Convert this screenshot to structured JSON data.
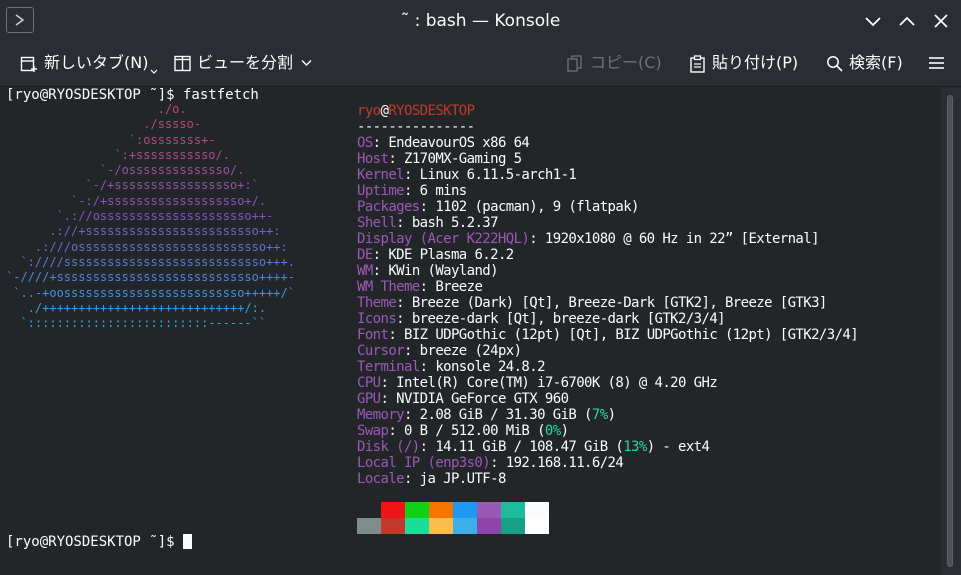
{
  "window": {
    "title": "˜ : bash — Konsole"
  },
  "toolbar": {
    "new_tab": "新しいタブ(N)",
    "split_view": "ビューを分割",
    "copy": "コピー(C)",
    "paste": "貼り付け(P)",
    "search": "検索(F)"
  },
  "terminal": {
    "prompt1": "[ryo@RYOSDESKTOP ˜]$ fastfetch",
    "prompt2": "[ryo@RYOSDESKTOP ˜]$ ",
    "user": "ryo",
    "at": "@",
    "host": "RYOSDESKTOP",
    "rule": "---------------",
    "info": [
      {
        "key": "OS",
        "sep": ": ",
        "value": "EndeavourOS x86 64"
      },
      {
        "key": "Host",
        "sep": ": ",
        "value": "Z170MX-Gaming 5"
      },
      {
        "key": "Kernel",
        "sep": ": ",
        "value": "Linux 6.11.5-arch1-1"
      },
      {
        "key": "Uptime",
        "sep": ": ",
        "value": "6 mins"
      },
      {
        "key": "Packages",
        "sep": ": ",
        "value": "1102 (pacman), 9 (flatpak)"
      },
      {
        "key": "Shell",
        "sep": ": ",
        "value": "bash 5.2.37"
      },
      {
        "key": "Display (Acer K222HQL)",
        "sep": ": ",
        "value": "1920x1080 @ 60 Hz in 22” [External]"
      },
      {
        "key": "DE",
        "sep": ": ",
        "value": "KDE Plasma 6.2.2"
      },
      {
        "key": "WM",
        "sep": ": ",
        "value": "KWin (Wayland)"
      },
      {
        "key": "WM Theme",
        "sep": ": ",
        "value": "Breeze"
      },
      {
        "key": "Theme",
        "sep": ": ",
        "value": "Breeze (Dark) [Qt], Breeze-Dark [GTK2], Breeze [GTK3]"
      },
      {
        "key": "Icons",
        "sep": ": ",
        "value": "breeze-dark [Qt], breeze-dark [GTK2/3/4]"
      },
      {
        "key": "Font",
        "sep": ": ",
        "value": "BIZ UDPGothic (12pt) [Qt], BIZ UDPGothic (12pt) [GTK2/3/4]"
      },
      {
        "key": "Cursor",
        "sep": ": ",
        "value": "breeze (24px)"
      },
      {
        "key": "Terminal",
        "sep": ": ",
        "value": "konsole 24.8.2"
      },
      {
        "key": "CPU",
        "sep": ": ",
        "value": "Intel(R) Core(TM) i7-6700K (8) @ 4.20 GHz"
      },
      {
        "key": "GPU",
        "sep": ": ",
        "value": "NVIDIA GeForce GTX 960"
      },
      {
        "key": "Memory",
        "sep": ": ",
        "value": "2.08 GiB / 31.30 GiB (",
        "pct": "7%",
        "tail": ")"
      },
      {
        "key": "Swap",
        "sep": ": ",
        "value": "0 B / 512.00 MiB (",
        "pct": "0%",
        "tail": ")"
      },
      {
        "key": "Disk (/)",
        "sep": ": ",
        "value": "14.11 GiB / 108.47 GiB (",
        "pct": "13%",
        "tail": ") - ext4"
      },
      {
        "key": "Local IP (enp3s0)",
        "sep": ": ",
        "value": "192.168.11.6/24"
      },
      {
        "key": "Locale",
        "sep": ": ",
        "value": "ja JP.UTF-8"
      }
    ],
    "logo": [
      "                     ./o.",
      "                   ./sssso-",
      "                 `:osssssss+-",
      "               `:+sssssssssso/.",
      "             `-/ossssssssssssso/.",
      "           `-/+sssssssssssssssso+:`",
      "         `-:/+sssssssssssssssssso+/.",
      "       `.://osssssssssssssssssssso++-",
      "      .://+ssssssssssssssssssssssso++:",
      "    .:///ossssssssssssssssssssssssso++:",
      "  `:////ssssssssssssssssssssssssssso+++.",
      "`-////+ssssssssssssssssssssssssssso++++-",
      " `..-+oosssssssssssssssssssssssso+++++/`",
      "   ./++++++++++++++++++++++++++++/:.",
      "  `:::::::::::::::::::::::::------``"
    ],
    "palette_top": [
      "#232629",
      "#ed1515",
      "#11d116",
      "#f67400",
      "#1d99f3",
      "#9b59b6",
      "#1abc9c",
      "#fcfcfc"
    ],
    "palette_bottom": [
      "#7f8c8d",
      "#c0392b",
      "#1cdc9a",
      "#fdbc4b",
      "#3daee9",
      "#8e44ad",
      "#16a085",
      "#ffffff"
    ]
  }
}
